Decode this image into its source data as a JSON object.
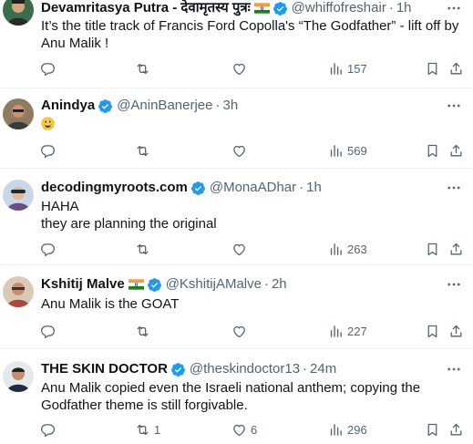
{
  "tweets": [
    {
      "name": "Devamritasya Putra - देवामृतस्य पुत्रः",
      "handle": "@whiffofreshair",
      "dot": "·",
      "time": "1h",
      "text": "It’s the title track of Francis Ford Copolla's “The Godfather” - lift off by Anu Malik !",
      "replies": "",
      "reposts": "",
      "likes": "",
      "views": "157"
    },
    {
      "name": "Anindya",
      "handle": "@AninBanerjee",
      "dot": "·",
      "time": "3h",
      "text": "",
      "replies": "",
      "reposts": "",
      "likes": "",
      "views": "569"
    },
    {
      "name": "decodingmyroots.com",
      "handle": "@MonaADhar",
      "dot": "·",
      "time": "1h",
      "text": "HAHA\nthey are planning the original",
      "replies": "",
      "reposts": "",
      "likes": "",
      "views": "263"
    },
    {
      "name": "Kshitij Malve",
      "handle": "@KshitijAMalve",
      "dot": "·",
      "time": "2h",
      "text": "Anu Malik is the GOAT",
      "replies": "",
      "reposts": "",
      "likes": "",
      "views": "227"
    },
    {
      "name": "THE SKIN DOCTOR",
      "handle": "@theskindoctor13",
      "dot": "·",
      "time": "24m",
      "text": "Anu Malik copied even the Israeli national anthem; copying the Godfather theme is still forgivable.",
      "replies": "",
      "reposts": "1",
      "likes": "6",
      "views": "296"
    }
  ],
  "colors": {
    "verified": "#1d9bf0",
    "secondary_text": "#536471",
    "primary_text": "#0f1419",
    "divider": "#eff3f4"
  },
  "icons": [
    "verified-badge-icon",
    "india-flag-icon",
    "more-icon",
    "reply-icon",
    "repost-icon",
    "like-icon",
    "views-icon",
    "bookmark-icon",
    "share-icon",
    "grinning-emoji-icon"
  ]
}
